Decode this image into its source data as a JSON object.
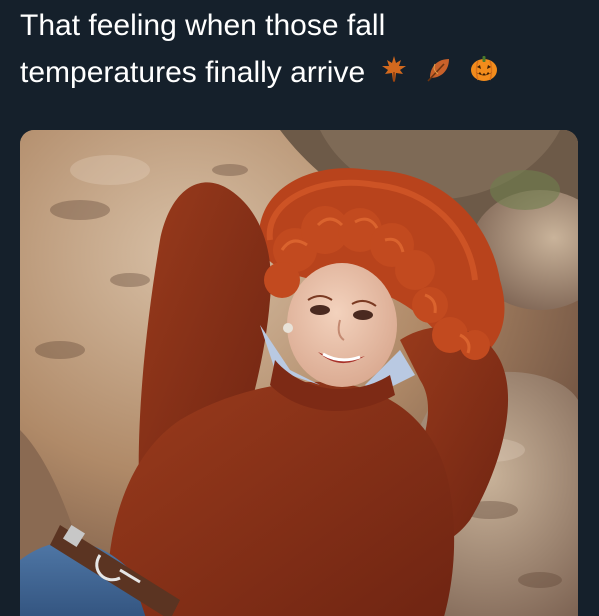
{
  "tweet": {
    "text_line_1": "That feeling when those fall",
    "text_line_2": "temperatures finally arrive",
    "emojis": [
      "maple-leaf",
      "fallen-leaf",
      "jack-o-lantern"
    ]
  },
  "media": {
    "kind": "photo",
    "subject": "woman-in-rust-sweater-lying-on-rocks"
  },
  "colors": {
    "background": "#15202b",
    "text": "#ffffff",
    "sweater": "#8a3318",
    "hair": "#c2491f",
    "rock": "#b99a7d"
  }
}
